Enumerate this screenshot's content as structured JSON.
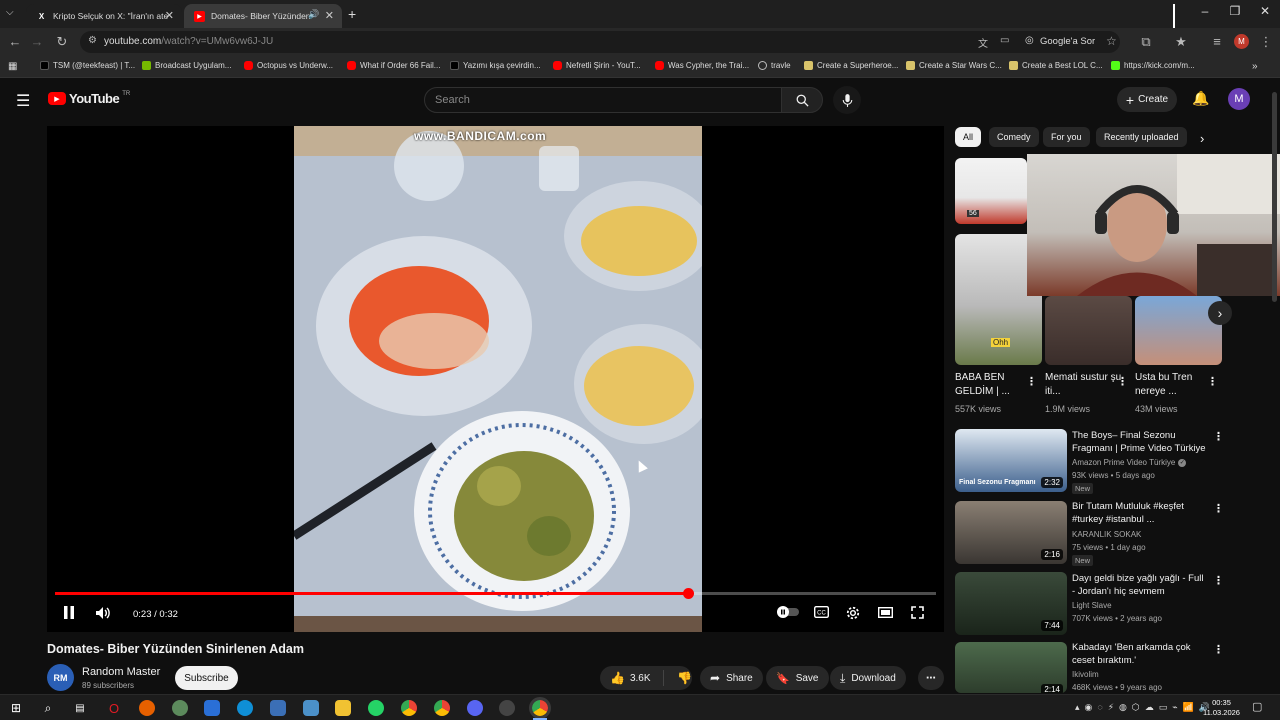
{
  "browser": {
    "tabs": [
      {
        "label": "Kripto Selçuk on X: \"İran'ın ate",
        "icon": "x-logo-icon"
      },
      {
        "label": "Domates- Biber Yüzünden",
        "icon": "youtube-icon"
      }
    ],
    "new_tab": "+",
    "url_domain": "youtube.com",
    "url_path": "/watch?v=UMw6vw6J-JU",
    "google_lens": "Google'a Sor",
    "profile_initial": "M"
  },
  "bookmarks": [
    "TSM (@teekfeast) | T...",
    "Broadcast Uygulam...",
    "Octopus vs Underw...",
    "What if Order 66 Fail...",
    "Yazımı kışa çevirdin...",
    "Nefretli Şirin - YouT...",
    "Was Cypher, the Trai...",
    "travle",
    "Create a Superheroe...",
    "Create a Star Wars C...",
    "Create a Best LOL C...",
    "https://kick.com/m..."
  ],
  "yt": {
    "logo": "YouTube",
    "region": "TR",
    "search_placeholder": "Search",
    "create_label": "Create",
    "avatar_initial": "M"
  },
  "player": {
    "watermark": "www.BANDICAM.com",
    "time": "0:23 / 0:32",
    "progress_fraction": 0.7188
  },
  "video": {
    "title": "Domates- Biber Yüzünden Sinirlenen Adam",
    "channel": "Random Master",
    "channel_initial": "RM",
    "subscribers": "89 subscribers",
    "subscribe_label": "Subscribe",
    "likes": "3.6K",
    "share_label": "Share",
    "save_label": "Save",
    "download_label": "Download"
  },
  "chips": [
    "All",
    "Comedy",
    "For you",
    "Recently uploaded"
  ],
  "shorts": [
    {
      "title": "BABA BEN GELDİM | ...",
      "views": "557K views",
      "badge": "Ohh"
    },
    {
      "title": "Memati sustur şu iti...",
      "views": "1.9M views"
    },
    {
      "title": "Usta  bu Tren nereye ...",
      "views": "43M views"
    }
  ],
  "short_top_badge": "56",
  "related": [
    {
      "title": "The Boys– Final Sezonu Fragmanı | Prime Video Türkiye",
      "channel": "Amazon Prime Video Türkiye",
      "meta": "93K views • 5 days ago",
      "duration": "2:32",
      "new": "New",
      "thumb_text": "Final Sezonu Fragmanı"
    },
    {
      "title": "Bir Tutam Mutluluk #keşfet #turkey #istanbul ...",
      "channel": "KARANLIK SOKAK",
      "meta": "75 views • 1 day ago",
      "duration": "2:16",
      "new": "New"
    },
    {
      "title": "Dayı geldi bize yağlı yağlı - Full - Jordan'ı hiç sevmem",
      "channel": "Light Slave",
      "meta": "707K views • 2 years ago",
      "duration": "7:44"
    },
    {
      "title": "Kabadayı 'Ben arkamda çok ceset bıraktım.'",
      "channel": "Ikivolim",
      "meta": "468K views • 9 years ago",
      "duration": "2:14"
    }
  ],
  "taskbar": {
    "time": "00:35",
    "date": "11.03.2026"
  },
  "colors": {
    "yt_red": "#ff0000",
    "background": "#0f0f0f",
    "surface": "#272727"
  }
}
